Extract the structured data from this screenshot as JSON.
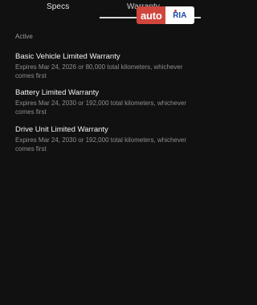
{
  "tabs": [
    {
      "label": "Specs"
    },
    {
      "label": "Warranty"
    }
  ],
  "watermark": {
    "left_text": "auto",
    "right_text": "RIA"
  },
  "section": {
    "label": "Active"
  },
  "warranties": [
    {
      "title": "Basic Vehicle Limited Warranty",
      "detail": "Expires Mar 24, 2026 or 80,000 total kilometers, whichever comes first"
    },
    {
      "title": "Battery Limited Warranty",
      "detail": "Expires Mar 24, 2030 or 192,000 total kilometers, whichever comes first"
    },
    {
      "title": "Drive Unit Limited Warranty",
      "detail": "Expires Mar 24, 2030 or 192,000 total kilometers, whichever comes first"
    }
  ]
}
